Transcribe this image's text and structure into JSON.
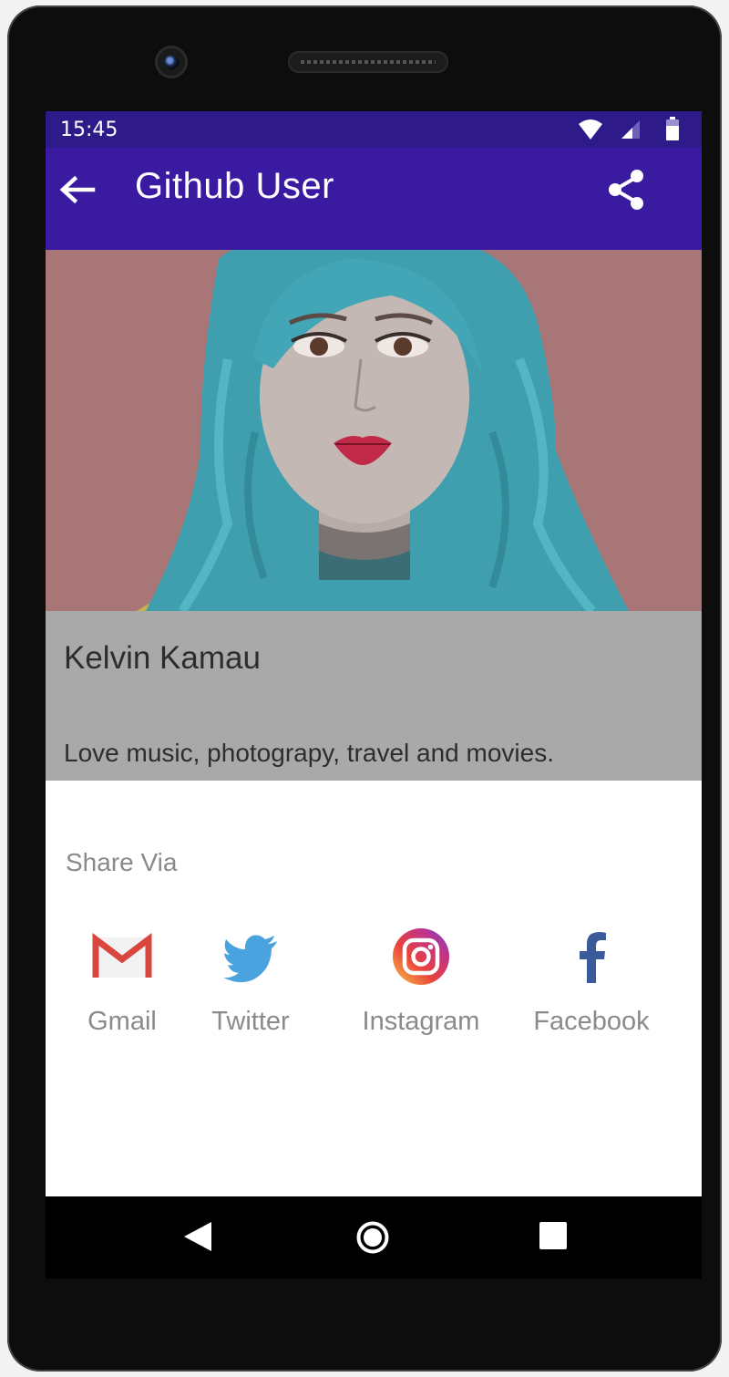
{
  "status_bar": {
    "time": "15:45"
  },
  "app_bar": {
    "title": "Github User",
    "back_icon": "arrow-back-icon",
    "share_icon": "share-icon"
  },
  "profile": {
    "name": "Kelvin Kamau",
    "bio": "Love music, photograpy, travel and movies.",
    "photo": "portrait-photo"
  },
  "share_sheet": {
    "title": "Share Via",
    "targets": [
      {
        "label": "Gmail",
        "icon": "gmail-icon"
      },
      {
        "label": "Twitter",
        "icon": "twitter-icon"
      },
      {
        "label": "Instagram",
        "icon": "instagram-icon"
      },
      {
        "label": "Facebook",
        "icon": "facebook-icon"
      }
    ]
  },
  "colors": {
    "status_bar": "#2f1a8a",
    "app_bar": "#3b1aa2",
    "photo_background": "#a87676",
    "hair": "#3fa7b6",
    "info_panel": "#a9a9a9"
  }
}
